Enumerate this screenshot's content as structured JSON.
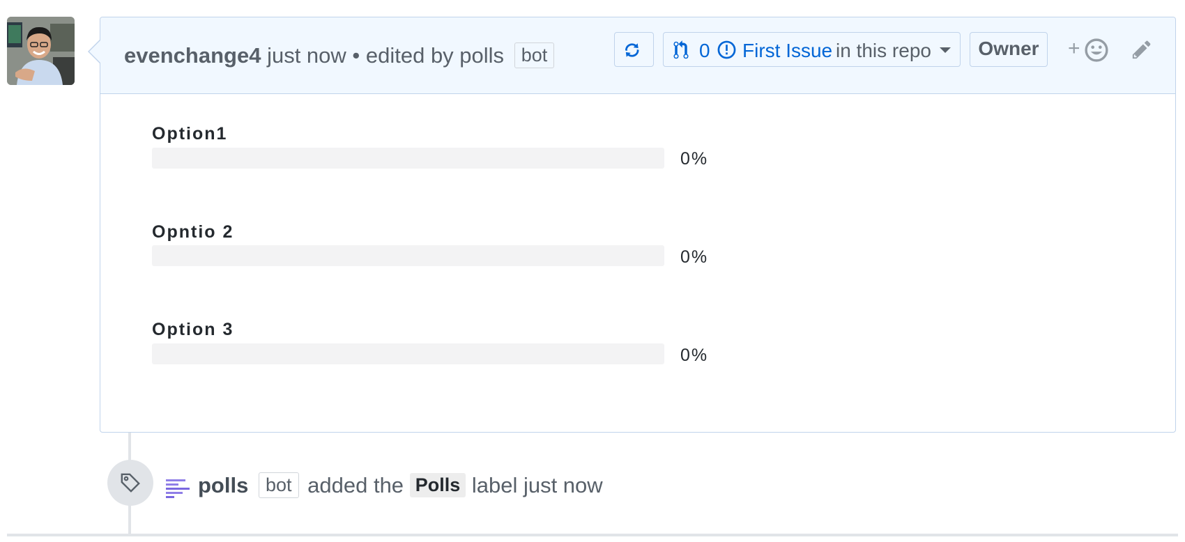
{
  "comment": {
    "author": "evenchange4",
    "meta": "just now • edited by polls",
    "editor_badge": "bot"
  },
  "toolbar": {
    "refresh_icon": "sync-icon",
    "linked_pr_count": "0",
    "issue_link": "First Issue",
    "issue_suffix": "in this repo",
    "owner_label": "Owner",
    "reaction_plus": "+",
    "reaction_icon": "smiley-icon",
    "edit_icon": "pencil-icon"
  },
  "poll": {
    "options": [
      {
        "label": "Option1",
        "percent_text": "0%",
        "fraction": 0
      },
      {
        "label": "Opntio 2",
        "percent_text": "0%",
        "fraction": 0
      },
      {
        "label": "Option 3",
        "percent_text": "0%",
        "fraction": 0
      }
    ],
    "bar_color": "#f3f3f4"
  },
  "event": {
    "actor": "polls",
    "actor_badge": "bot",
    "action": "added the",
    "label": "Polls",
    "suffix": "label just now",
    "icon": "tag-icon"
  },
  "colors": {
    "header_bg": "#f1f8ff",
    "border": "#c0d3eb",
    "link": "#0366d6"
  }
}
